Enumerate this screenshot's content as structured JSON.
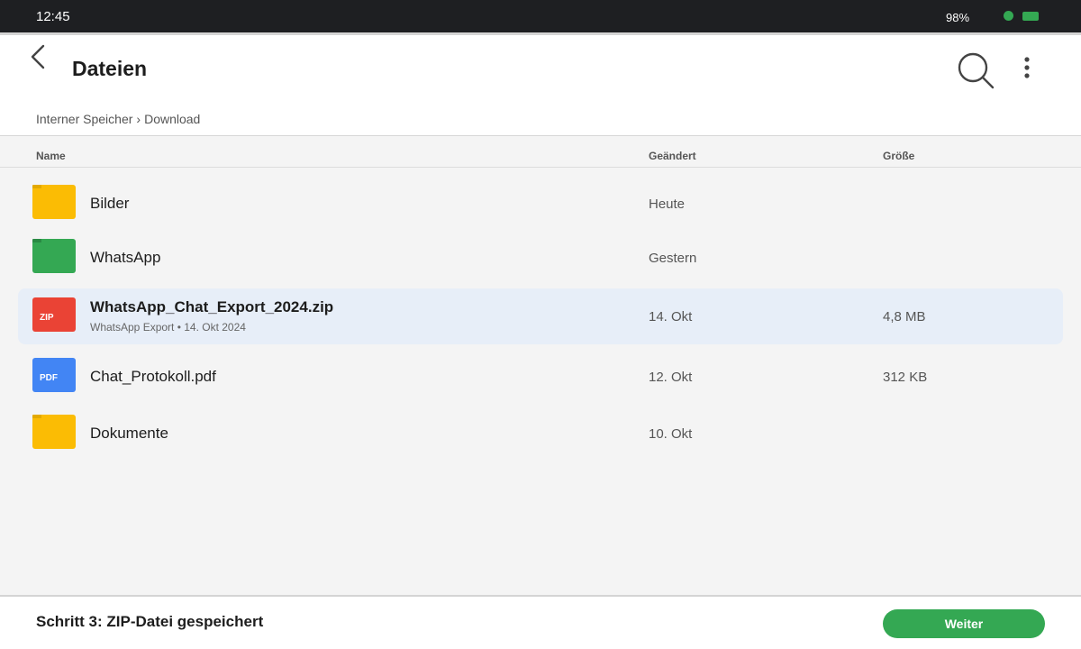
{
  "status_bar": {
    "time": "12:45",
    "battery_text": "98%",
    "dot_color": "#34a853",
    "battery_color": "#34a853"
  },
  "header": {
    "title": "Dateien",
    "back_icon": "chevron-left-icon",
    "search_icon": "search-icon",
    "more_icon": "more-vertical-icon"
  },
  "breadcrumb": {
    "root": "Interner Speicher",
    "separator": "›",
    "current": "Download"
  },
  "columns": {
    "name": "Name",
    "modified": "Geändert",
    "size": "Größe"
  },
  "files": [
    {
      "name": "Bilder",
      "type": "folder",
      "icon_color": "#fbbc04",
      "tab_color": "#e3a900",
      "modified": "Heute",
      "size": "",
      "subtitle": "",
      "selected": false
    },
    {
      "name": "WhatsApp",
      "type": "folder",
      "icon_color": "#34a853",
      "tab_color": "#2a8a44",
      "modified": "Gestern",
      "size": "",
      "subtitle": "",
      "selected": false
    },
    {
      "name": "WhatsApp_Chat_Export_2024.zip",
      "type": "zip",
      "icon_label": "ZIP",
      "icon_color": "#ea4335",
      "modified": "14. Okt",
      "size": "4,8 MB",
      "subtitle": "WhatsApp Export • 14. Okt 2024",
      "selected": true
    },
    {
      "name": "Chat_Protokoll.pdf",
      "type": "pdf",
      "icon_label": "PDF",
      "icon_color": "#4285f4",
      "modified": "12. Okt",
      "size": "312 KB",
      "subtitle": "",
      "selected": false
    },
    {
      "name": "Dokumente",
      "type": "folder",
      "icon_color": "#fbbc04",
      "tab_color": "#e3a900",
      "modified": "10. Okt",
      "size": "",
      "subtitle": "",
      "selected": false
    }
  ],
  "bottom_bar": {
    "step_label": "Schritt 3: ZIP-Datei gespeichert",
    "next_label": "Weiter",
    "next_color": "#34a853"
  }
}
